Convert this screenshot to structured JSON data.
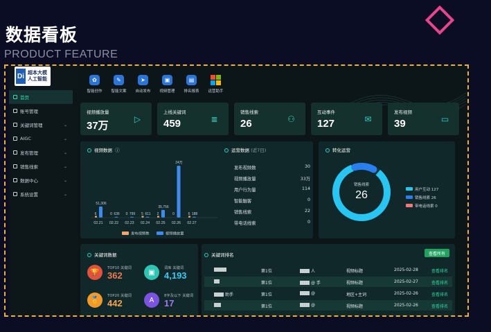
{
  "hero": {
    "title": "数据看板",
    "subtitle": "PRODUCT FEATURE"
  },
  "colors": {
    "accent": "#2fd0c0",
    "frame": "#f0b323",
    "diamond": "#e8448f",
    "bar": "#3b8bf0",
    "bar_alt": "#f5a56b"
  },
  "logo": {
    "mark": "Di",
    "line1": "超本大模",
    "line2": "人工智能"
  },
  "sidebar": {
    "items": [
      {
        "label": "首页",
        "icon": "home-icon",
        "active": true
      },
      {
        "label": "账号管理",
        "icon": "account-icon"
      },
      {
        "label": "关键词管理",
        "icon": "gear-icon",
        "chevron": "⌄"
      },
      {
        "label": "AIGC",
        "icon": "aigc-icon",
        "chevron": "⌄"
      },
      {
        "label": "发布管理",
        "icon": "publish-icon",
        "chevron": "⌄"
      },
      {
        "label": "销售线索",
        "icon": "chart-icon",
        "chevron": "⌄"
      },
      {
        "label": "数据中心",
        "icon": "data-icon",
        "chevron": "⌄"
      },
      {
        "label": "系统设置",
        "icon": "settings-icon",
        "chevron": "⌄"
      }
    ]
  },
  "toolbar": [
    {
      "label": "智能创作",
      "icon": "create-icon",
      "glyph": "✿"
    },
    {
      "label": "智能文案",
      "icon": "copywriting-icon",
      "glyph": "✎"
    },
    {
      "label": "自动发布",
      "icon": "send-icon",
      "glyph": "➤"
    },
    {
      "label": "视频管理",
      "icon": "video-icon",
      "glyph": "▣"
    },
    {
      "label": "排名报表",
      "icon": "report-icon",
      "glyph": "▤"
    },
    {
      "label": "运营助手",
      "icon": "windows-icon",
      "glyph": ""
    }
  ],
  "stats": [
    {
      "title": "视频播放量",
      "value": "37万",
      "icon": "play-icon",
      "glyph": "▷"
    },
    {
      "title": "上线关键词",
      "value": "459",
      "icon": "keyword-icon",
      "glyph": "≣"
    },
    {
      "title": "销售线索",
      "value": "26",
      "icon": "user-icon",
      "glyph": "⚇"
    },
    {
      "title": "互动事件",
      "value": "127",
      "icon": "chat-icon",
      "glyph": "✉"
    },
    {
      "title": "发布视频",
      "value": "39",
      "icon": "camera-icon",
      "glyph": "▭"
    }
  ],
  "video_panel": {
    "title": "视频数据",
    "info": "ⓘ"
  },
  "chart_data": {
    "type": "bar",
    "categories": [
      "02.21",
      "02.22",
      "02.23",
      "02.24",
      "02.25",
      "02.26",
      "02.27"
    ],
    "series": [
      {
        "name": "发布视频数",
        "values": [
          6,
          0,
          0,
          5,
          2,
          0,
          6
        ]
      },
      {
        "name": "视频播放量",
        "values": [
          51306,
          636,
          799,
          611,
          35756,
          240000,
          188
        ]
      }
    ],
    "data_labels": {
      "发布视频数": [
        "6",
        "0",
        "0",
        "5",
        "2",
        "0",
        "6"
      ],
      "视频播放量": [
        "51,306",
        "636",
        "799",
        "611",
        "35,756",
        "24万",
        "188"
      ]
    },
    "ylim": [
      0,
      250000
    ],
    "legend": "bottom",
    "grid": false
  },
  "ops": {
    "title": "运营数据",
    "period": "(近7日)",
    "rows": [
      {
        "label": "发布视频数",
        "value": "30"
      },
      {
        "label": "视频播放量",
        "value": "33万"
      },
      {
        "label": "用户行为量",
        "value": "114"
      },
      {
        "label": "智能触客",
        "value": "0"
      },
      {
        "label": "销售线索",
        "value": "22"
      },
      {
        "label": "带电话线索",
        "value": "0"
      }
    ]
  },
  "conversion": {
    "title": "转化运营",
    "center_label": "销售线索",
    "center_value": "26",
    "legend": [
      {
        "label": "用户互动 127",
        "color": "#27c6f2"
      },
      {
        "label": "销售线索 26",
        "color": "#2a7ff0"
      },
      {
        "label": "带电话线索 0",
        "color": "#f07a7a"
      }
    ],
    "fraction_cyan": 0.83,
    "fraction_blue": 0.12
  },
  "keywords": {
    "title": "关键词数据",
    "items": [
      {
        "label": "TOP10 关键词",
        "value": "362",
        "icon": "trophy-icon",
        "glyph": "🏆",
        "color": "#f07a4f",
        "bg": "#e2513a"
      },
      {
        "label": "词库 关键词",
        "value": "4,193",
        "icon": "image-icon",
        "glyph": "▣",
        "color": "#37c9f2",
        "bg": "#2cc6b4"
      },
      {
        "label": "TOP20 关键词",
        "value": "442",
        "icon": "medal-icon",
        "glyph": "🏅",
        "color": "#f5a34a",
        "bg": "#f19a2a"
      },
      {
        "label": "8字及以下 关键词",
        "value": "17",
        "icon": "letter-icon",
        "glyph": "A",
        "color": "#a07af5",
        "bg": "#7b53e0"
      }
    ]
  },
  "ranking": {
    "title": "关键词排名",
    "view_all": "查看所有",
    "rows": [
      {
        "rank": "第1位",
        "account": "人",
        "type": "视频标题",
        "date": "2025-02-28",
        "action": "查看排名"
      },
      {
        "rank": "第1位",
        "account": "@ 手",
        "type": "视频标题",
        "date": "2025-02-27",
        "action": "查看排名"
      },
      {
        "keyword": "助手",
        "rank": "第1位",
        "account": "@",
        "type": "地区+主词",
        "date": "2025-02-26",
        "action": "查看排名"
      },
      {
        "rank": "第1位",
        "account": "@",
        "type": "视频标题",
        "date": "2025-02-26",
        "action": "查看排名"
      }
    ]
  }
}
